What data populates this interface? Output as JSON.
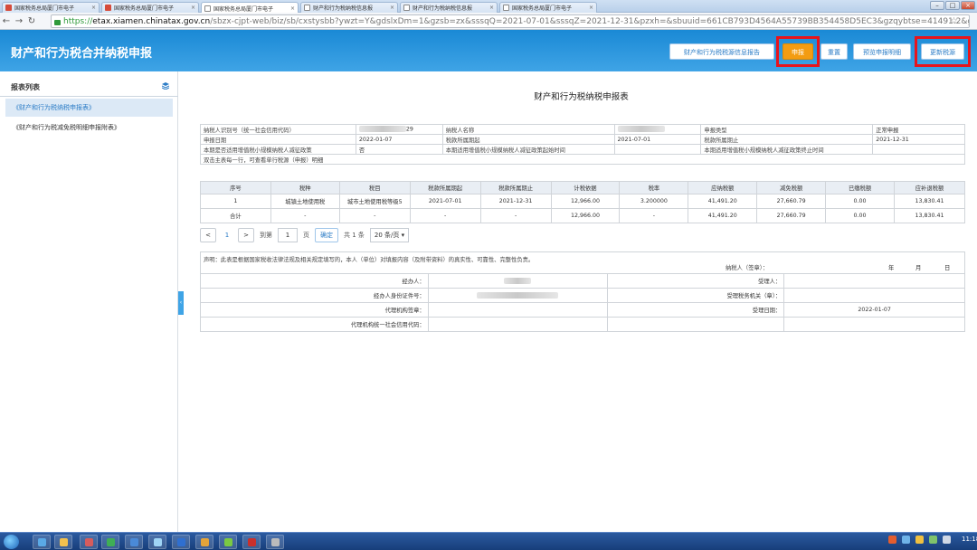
{
  "browser": {
    "tabs": [
      {
        "label": "国家税务总局厦门市电子",
        "icon": "red",
        "active": false
      },
      {
        "label": "国家税务总局厦门市电子",
        "icon": "red",
        "active": false
      },
      {
        "label": "国家税务总局厦门市电子",
        "icon": "doc",
        "active": true
      },
      {
        "label": "财产和行为税纳税信息报",
        "icon": "doc",
        "active": false
      },
      {
        "label": "财产和行为税纳税信息报",
        "icon": "doc",
        "active": false
      },
      {
        "label": "国家税务总局厦门市电子",
        "icon": "doc",
        "active": false
      }
    ],
    "url_scheme": "https://",
    "url_host": "etax.xiamen.chinatax.gov.cn",
    "url_path": "/sbzx-cjpt-web/biz/sb/cxstysbb?ywzt=Y&gdslxDm=1&gzsb=zx&sssqQ=2021-07-01&sssqZ=2021-12-31&pzxh=&sbuuid=661CB793D4564A55739BB354458D5EC3&gzqybtse=41491.2&gzsjlyb"
  },
  "header": {
    "title": "财产和行为税合并纳税申报",
    "buttons": {
      "info_report": "财产和行为税税源信息报告",
      "submit": "申报",
      "reset": "重置",
      "preview": "预览申报明细",
      "update_source": "更新税源"
    }
  },
  "sidebar": {
    "title": "报表列表",
    "items": [
      "《财产和行为税纳税申报表》",
      "《财产和行为税减免税明细申报附表》"
    ]
  },
  "form": {
    "title": "财产和行为税纳税申报表",
    "info": {
      "taxpayer_id_label": "纳税人识别号（统一社会信用代码）",
      "taxpayer_id_suffix": "29",
      "taxpayer_name_label": "纳税人名称",
      "decl_type_label": "申报类型",
      "decl_type_value": "正常申报",
      "decl_date_label": "申报日期",
      "decl_date_value": "2022-01-07",
      "period_start_label": "税款所属期起",
      "period_start_value": "2021-07-01",
      "period_end_label": "税款所属期止",
      "period_end_value": "2021-12-31",
      "small_policy_label": "本期是否适用增值税小规模纳税人减征政策",
      "small_policy_value": "否",
      "small_start_label": "本期适用增值税小规模纳税人减征政策起始时间",
      "small_end_label": "本期适用增值税小规模纳税人减征政策终止时间",
      "hint": "双击主表每一行，可查看单行税源（申报）明细"
    },
    "columns": [
      "序号",
      "税种",
      "税目",
      "税款所属期起",
      "税款所属期止",
      "计税依据",
      "税率",
      "应纳税额",
      "减免税额",
      "已缴税额",
      "应补退税额"
    ],
    "rows": [
      [
        "1",
        "城镇土地使用税",
        "城市土地使用税等级5",
        "2021-07-01",
        "2021-12-31",
        "12,966.00",
        "3.200000",
        "41,491.20",
        "27,660.79",
        "0.00",
        "13,830.41"
      ],
      [
        "合计",
        "-",
        "-",
        "-",
        "-",
        "12,966.00",
        "-",
        "41,491.20",
        "27,660.79",
        "0.00",
        "13,830.41"
      ]
    ]
  },
  "pager": {
    "prev": "<",
    "page": "1",
    "next": ">",
    "goto_label": "到第",
    "goto_value": "1",
    "page_unit": "页",
    "confirm": "确定",
    "total": "共 1 条",
    "per_page": "20 条/页"
  },
  "declaration": {
    "text": "声明：此表是根据国家税收法律法规及相关规定填写的，本人（单位）对填报内容（及附带资料）的真实性、可靠性、完整性负责。",
    "signature_label": "纳税人（签章）：",
    "year": "年",
    "month": "月",
    "day": "日",
    "agent_label": "经办人：",
    "agent_id_label": "经办人身份证件号：",
    "agency_seal_label": "代理机构签章：",
    "agency_code_label": "代理机构统一社会信用代码：",
    "receiver_label": "受理人：",
    "receiver_office_label": "受理税务机关（章）：",
    "receive_date_label": "受理日期：",
    "receive_date_value": "2022-01-07"
  },
  "taskbar": {
    "time": "11:18"
  },
  "colors": {
    "header_blue": "#1a89d5",
    "accent_orange": "#f39c12",
    "highlight_red": "#e8141c"
  }
}
